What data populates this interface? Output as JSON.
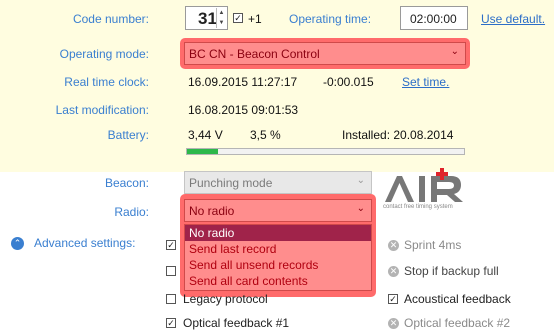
{
  "labels": {
    "code_number": "Code number:",
    "operating_mode": "Operating mode:",
    "real_time_clock": "Real time clock:",
    "last_modification": "Last modification:",
    "battery": "Battery:",
    "beacon": "Beacon:",
    "radio": "Radio:",
    "advanced_settings": "Advanced settings:"
  },
  "code": {
    "value": "31",
    "plus1_checked": true,
    "plus1_label": "+1"
  },
  "operating_time": {
    "label": "Operating time:",
    "value": "02:00:00",
    "use_default": "Use default."
  },
  "operating_mode": {
    "selected": "BC CN - Beacon Control"
  },
  "clock": {
    "datetime": "16.09.2015 11:27:17",
    "offset": "-0:00.015",
    "set_time": "Set time."
  },
  "last_modification": {
    "value": "16.08.2015 09:01:53"
  },
  "battery": {
    "voltage": "3,44 V",
    "percent": "3,5 %",
    "level_fraction": 0.035,
    "installed": "Installed: 20.08.2014"
  },
  "beacon": {
    "selected": "Punching mode"
  },
  "radio": {
    "selected": "No radio",
    "options": [
      "No radio",
      "Send last record",
      "Send all unsend records",
      "Send all card contents"
    ],
    "highlighted_index": 0
  },
  "logo": {
    "text": "AIR+",
    "tagline": "contact free timing system"
  },
  "advanced": {
    "left": [
      {
        "label": "Legacy protocol",
        "checked": false
      },
      {
        "label": "Optical feedback #1",
        "checked": true
      }
    ],
    "right": [
      {
        "label": "Sprint 4ms",
        "enabled": false
      },
      {
        "label": "Stop if backup full",
        "enabled": false
      },
      {
        "label": "Acoustical feedback",
        "checked": true,
        "enabled": true
      },
      {
        "label": "Optical feedback #2",
        "enabled": false
      }
    ]
  },
  "colors": {
    "label_blue": "#3a7fd0",
    "highlight_red": "#ff6b6b",
    "battery_green": "#2db84a",
    "background_yellow": "#fffde0"
  }
}
